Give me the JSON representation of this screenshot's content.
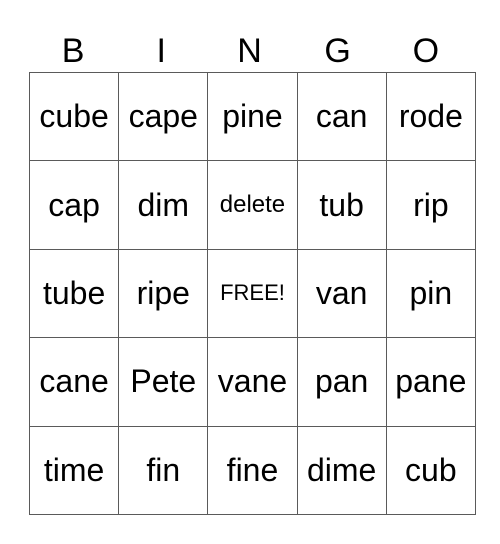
{
  "header": {
    "letters": [
      "B",
      "I",
      "N",
      "G",
      "O"
    ]
  },
  "board": {
    "rows": [
      [
        "cube",
        "cape",
        "pine",
        "can",
        "rode"
      ],
      [
        "cap",
        "dim",
        "delete",
        "tub",
        "rip"
      ],
      [
        "tube",
        "ripe",
        "FREE!",
        "van",
        "pin"
      ],
      [
        "cane",
        "Pete",
        "vane",
        "pan",
        "pane"
      ],
      [
        "time",
        "fin",
        "fine",
        "dime",
        "cub"
      ]
    ]
  },
  "colors": {
    "grid_line": "#5a5a5a",
    "text": "#000000",
    "background": "#ffffff"
  }
}
